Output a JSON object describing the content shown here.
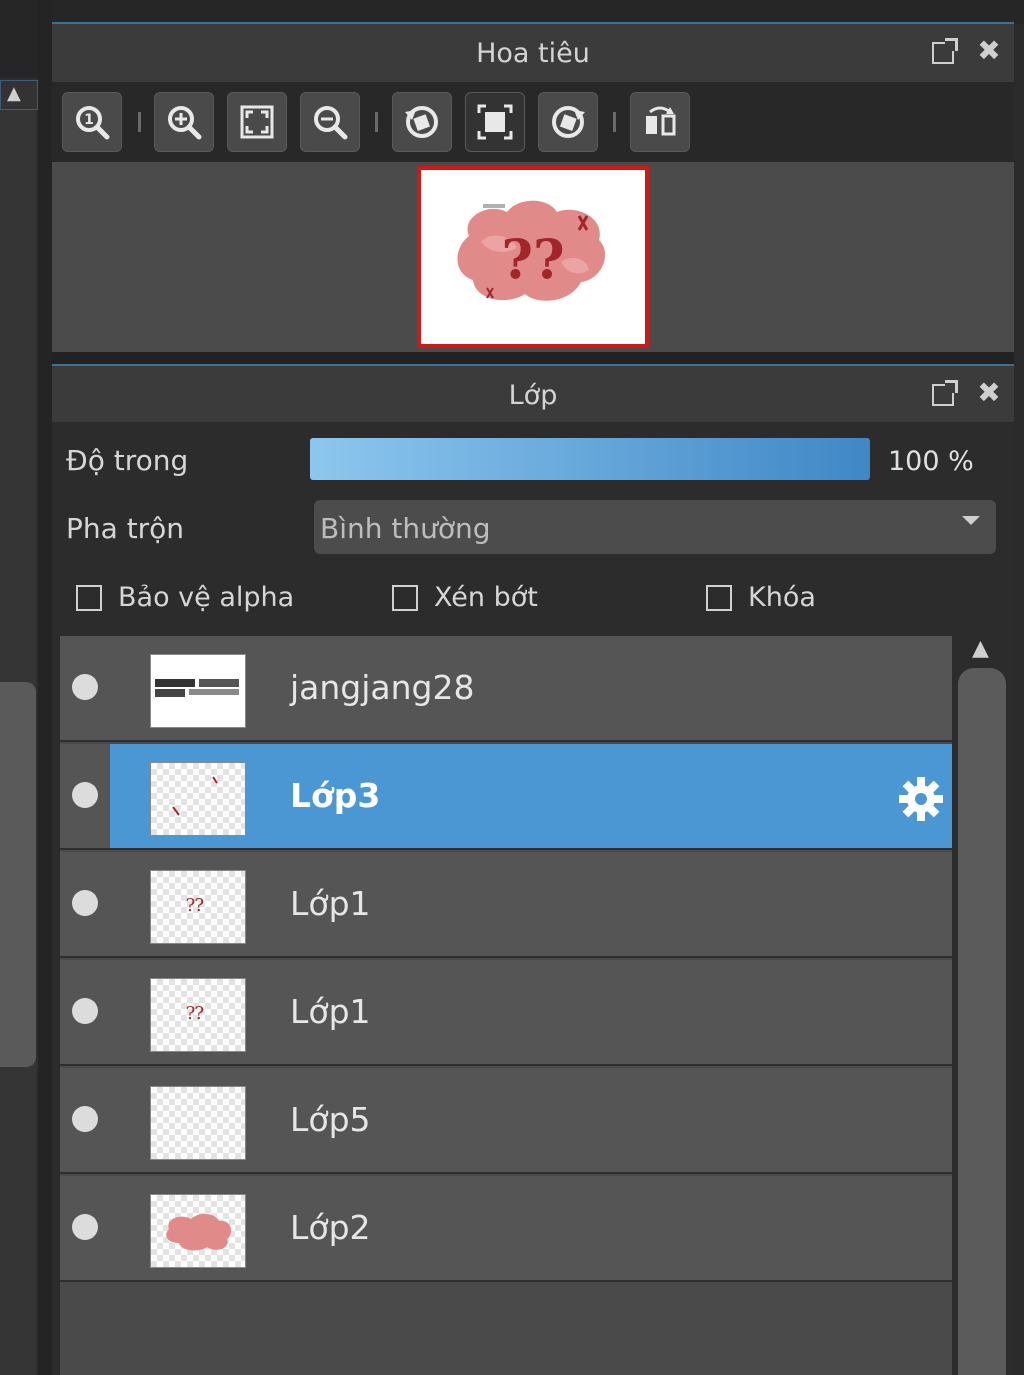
{
  "navigator": {
    "title": "Hoa tiêu",
    "toolbar": [
      "zoom-actual-icon",
      "zoom-in-icon",
      "fit-window-icon",
      "zoom-out-icon",
      "rotate-left-icon",
      "fit-canvas-icon",
      "rotate-right-icon",
      "flip-horizontal-icon"
    ],
    "preview_text": "??"
  },
  "layers": {
    "title": "Lớp",
    "opacity_label": "Độ trong",
    "opacity_value": "100 %",
    "opacity_fraction": 1.0,
    "blend_label": "Pha trộn",
    "blend_value": "Bình thường",
    "checkboxes": {
      "protect_alpha": "Bảo vệ alpha",
      "clipping": "Xén bớt",
      "lock": "Khóa"
    },
    "items": [
      {
        "name": "jangjang28",
        "selected": false
      },
      {
        "name": "Lớp3",
        "selected": true
      },
      {
        "name": "Lớp1",
        "selected": false
      },
      {
        "name": "Lớp1",
        "selected": false
      },
      {
        "name": "Lớp5",
        "selected": false
      },
      {
        "name": "Lớp2",
        "selected": false
      }
    ]
  },
  "colors": {
    "accent": "#4a97d3",
    "navigator_frame": "#d01818",
    "cloud": "#e08a8a",
    "mark": "#a0262a"
  }
}
